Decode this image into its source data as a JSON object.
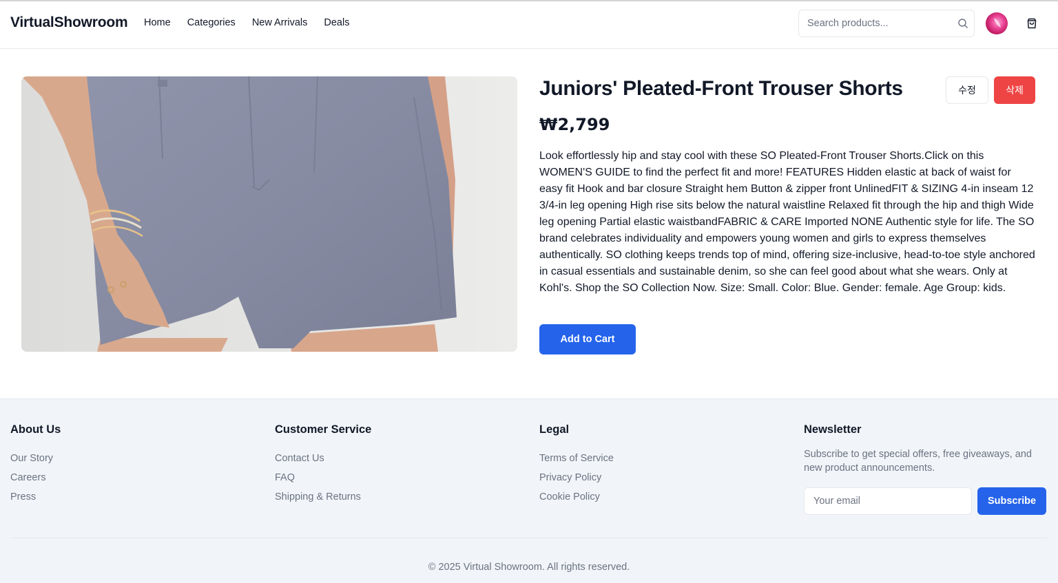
{
  "header": {
    "brand": "VirtualShowroom",
    "nav": [
      "Home",
      "Categories",
      "New Arrivals",
      "Deals"
    ],
    "search_placeholder": "Search products...",
    "icons": {
      "search": "search-icon",
      "avatar": "avatar",
      "cart": "shopping-bag-icon"
    }
  },
  "product": {
    "image_alt": "Juniors' Pleated-Front Trouser Shorts",
    "title": "Juniors' Pleated-Front Trouser Shorts",
    "price": "₩2,799",
    "description": "Look effortlessly hip and stay cool with these SO Pleated-Front Trouser Shorts.Click on this WOMEN'S GUIDE to find the perfect fit and more! FEATURES Hidden elastic at back of waist for easy fit Hook and bar closure Straight hem Button & zipper front UnlinedFIT & SIZING 4-in inseam 12 3/4-in leg opening High rise sits below the natural waistline Relaxed fit through the hip and thigh Wide leg opening Partial elastic waistbandFABRIC & CARE Imported NONE Authentic style for life. The SO brand celebrates individuality and empowers young women and girls to express themselves authentically. SO clothing keeps trends top of mind, offering size-inclusive, head-to-toe style anchored in casual essentials and sustainable denim, so she can feel good about what she wears. Only at Kohl's. Shop the SO Collection Now. Size: Small. Color: Blue. Gender: female. Age Group: kids.",
    "edit_label": "수정",
    "delete_label": "삭제",
    "add_to_cart_label": "Add to Cart"
  },
  "footer": {
    "about": {
      "title": "About Us",
      "links": [
        "Our Story",
        "Careers",
        "Press"
      ]
    },
    "service": {
      "title": "Customer Service",
      "links": [
        "Contact Us",
        "FAQ",
        "Shipping & Returns"
      ]
    },
    "legal": {
      "title": "Legal",
      "links": [
        "Terms of Service",
        "Privacy Policy",
        "Cookie Policy"
      ]
    },
    "newsletter": {
      "title": "Newsletter",
      "text": "Subscribe to get special offers, free giveaways, and new product announcements.",
      "email_placeholder": "Your email",
      "subscribe_label": "Subscribe"
    },
    "copyright": "© 2025 Virtual Showroom. All rights reserved."
  },
  "colors": {
    "primary": "#2563eb",
    "danger": "#ef4444",
    "footer_bg": "#f1f5f9",
    "muted_text": "#6b7280",
    "product_fabric": "#8a8fa6"
  }
}
